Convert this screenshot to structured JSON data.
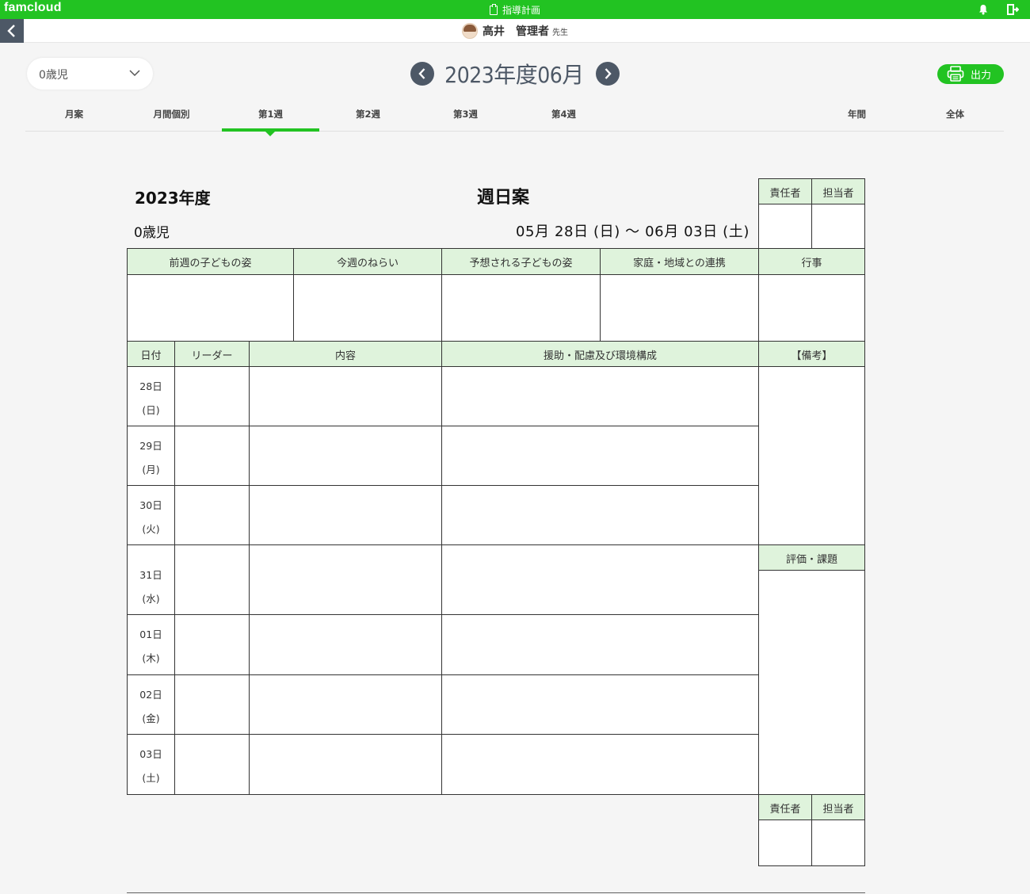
{
  "app": {
    "logo": "famcloud",
    "page_title": "指導計画",
    "brand_color": "#22c322",
    "icons": [
      "clipboard-icon",
      "bell-icon",
      "logout-icon",
      "back-icon",
      "chevron-down-icon",
      "printer-icon"
    ]
  },
  "user": {
    "family_name": "高井",
    "role": "管理者",
    "suffix": "先生"
  },
  "controls": {
    "class_select_value": "0歳児",
    "period_title": "2023年度06月",
    "print_label": "出力"
  },
  "tabs": [
    {
      "label": "月案",
      "active": false
    },
    {
      "label": "月間個別",
      "active": false
    },
    {
      "label": "第1週",
      "active": true
    },
    {
      "label": "第2週",
      "active": false
    },
    {
      "label": "第3週",
      "active": false
    },
    {
      "label": "第4週",
      "active": false
    },
    {
      "label": "年間",
      "active": false
    },
    {
      "label": "全体",
      "active": false
    }
  ],
  "document": {
    "year": "2023年度",
    "title": "週日案",
    "class_name": "0歳児",
    "date_range": "05月 28日 (日) ～ 06月 03日 (土)",
    "sign_headers": [
      "責任者",
      "担当者"
    ],
    "top_headers": [
      "前週の子どもの姿",
      "今週のねらい",
      "予想される子どもの姿",
      "家庭・地域との連携",
      "行事"
    ],
    "daily_headers": [
      "日付",
      "リーダー",
      "内容",
      "援助・配慮及び環境構成",
      "【備考】"
    ],
    "evaluation_header": "評価・課題",
    "bottom_sign_headers": [
      "責任者",
      "担当者"
    ],
    "days": [
      {
        "date": "28日",
        "weekday": "(日)"
      },
      {
        "date": "29日",
        "weekday": "(月)"
      },
      {
        "date": "30日",
        "weekday": "(火)"
      },
      {
        "date": "31日",
        "weekday": "(水)"
      },
      {
        "date": "01日",
        "weekday": "(木)"
      },
      {
        "date": "02日",
        "weekday": "(金)"
      },
      {
        "date": "03日",
        "weekday": "(土)"
      }
    ]
  }
}
